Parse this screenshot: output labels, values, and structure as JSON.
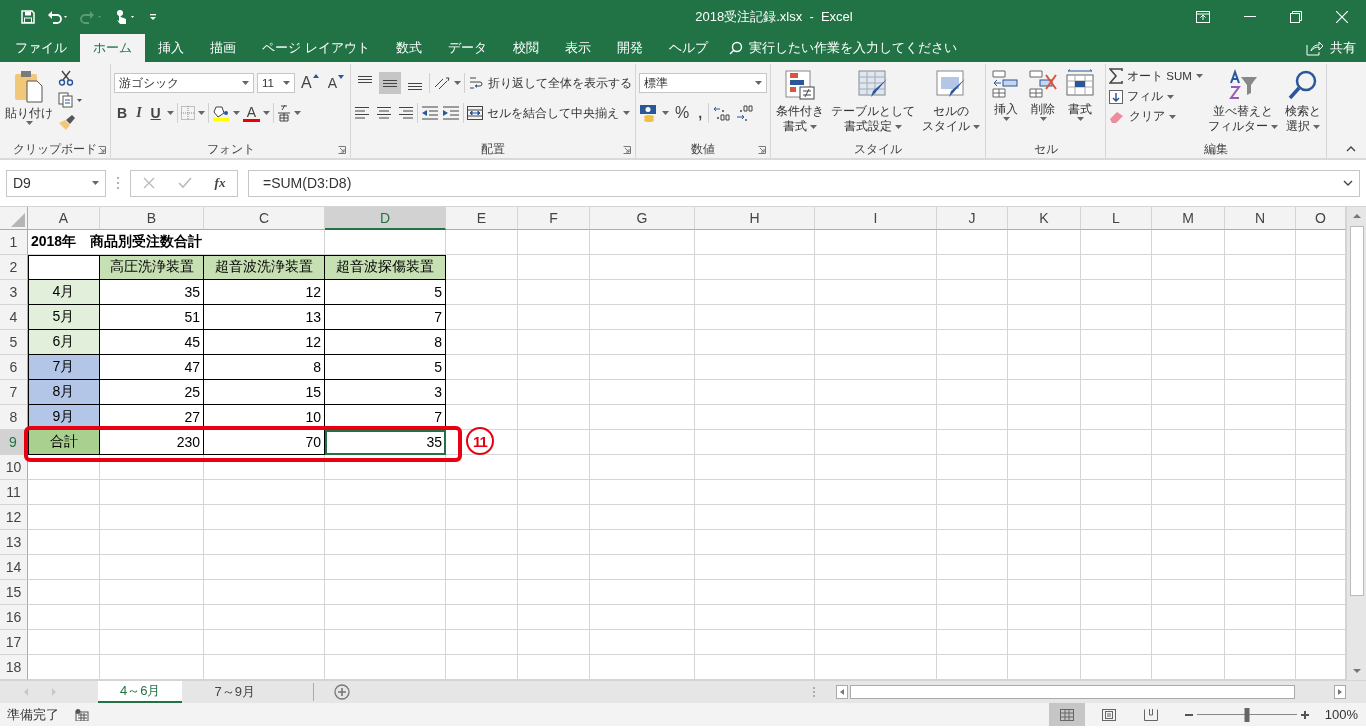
{
  "window": {
    "title": "2018受注記録.xlsx  -  Excel",
    "share": "共有"
  },
  "menu_tabs": [
    {
      "label": "ファイル",
      "selected": false
    },
    {
      "label": "ホーム",
      "selected": true
    },
    {
      "label": "挿入",
      "selected": false
    },
    {
      "label": "描画",
      "selected": false
    },
    {
      "label": "ページ レイアウト",
      "selected": false
    },
    {
      "label": "数式",
      "selected": false
    },
    {
      "label": "データ",
      "selected": false
    },
    {
      "label": "校閲",
      "selected": false
    },
    {
      "label": "表示",
      "selected": false
    },
    {
      "label": "開発",
      "selected": false
    },
    {
      "label": "ヘルプ",
      "selected": false
    }
  ],
  "tell_me": "実行したい作業を入力してください",
  "ribbon": {
    "clipboard": {
      "paste": "貼り付け",
      "group": "クリップボード"
    },
    "font": {
      "name": "游ゴシック",
      "size": "11",
      "grow": "A",
      "shrink": "A",
      "bold": "B",
      "italic": "I",
      "underline": "U",
      "font_color_label": "A",
      "group": "フォント"
    },
    "alignment": {
      "vertical": [
        {
          "selected": false
        },
        {
          "selected": true
        },
        {
          "selected": false
        }
      ],
      "wrap": "折り返して全体を表示する",
      "merge": "セルを結合して中央揃え",
      "group": "配置"
    },
    "number": {
      "format": "標準",
      "percent": "%",
      "comma": ",",
      "group": "数値"
    },
    "styles": {
      "buttons": [
        [
          "条件付き",
          "書式"
        ],
        [
          "テーブルとして",
          "書式設定"
        ],
        [
          "セルの",
          "スタイル"
        ]
      ],
      "group": "スタイル"
    },
    "cells": {
      "buttons": [
        "挿入",
        "削除",
        "書式"
      ],
      "group": "セル"
    },
    "editing": {
      "autosum": "オート SUM",
      "fill": "フィル",
      "clear": "クリア",
      "sort": [
        "並べ替えと",
        "フィルター"
      ],
      "find": [
        "検索と",
        "選択"
      ],
      "group": "編集"
    }
  },
  "formula_bar": {
    "name_box": "D9",
    "fx": "fx",
    "formula": "=SUM(D3:D8)"
  },
  "grid": {
    "columns": [
      {
        "label": "A",
        "selected": false
      },
      {
        "label": "B",
        "selected": false
      },
      {
        "label": "C",
        "selected": false
      },
      {
        "label": "D",
        "selected": true
      },
      {
        "label": "E",
        "selected": false
      },
      {
        "label": "F",
        "selected": false
      },
      {
        "label": "G",
        "selected": false
      },
      {
        "label": "H",
        "selected": false
      },
      {
        "label": "I",
        "selected": false
      },
      {
        "label": "J",
        "selected": false
      },
      {
        "label": "K",
        "selected": false
      },
      {
        "label": "L",
        "selected": false
      },
      {
        "label": "M",
        "selected": false
      },
      {
        "label": "N",
        "selected": false
      },
      {
        "label": "O",
        "selected": false
      }
    ],
    "rows": [
      {
        "number": "1",
        "selected": false,
        "cells": [
          {
            "kind": "title",
            "text": "2018年　商品別受注数合計"
          }
        ]
      },
      {
        "number": "2",
        "selected": false,
        "cells": [
          {
            "kind": "blank"
          },
          {
            "kind": "header",
            "text": "高圧洗浄装置",
            "color": "#c6e0b4"
          },
          {
            "kind": "header",
            "text": "超音波洗浄装置",
            "color": "#c6e0b4"
          },
          {
            "kind": "header",
            "text": "超音波探傷装置",
            "color": "#c6e0b4"
          }
        ]
      },
      {
        "number": "3",
        "selected": false,
        "cells": [
          {
            "kind": "label",
            "text": "4月",
            "color": "#e2efda"
          },
          {
            "kind": "number",
            "text": "35"
          },
          {
            "kind": "number",
            "text": "12"
          },
          {
            "kind": "number",
            "text": "5"
          }
        ]
      },
      {
        "number": "4",
        "selected": false,
        "cells": [
          {
            "kind": "label",
            "text": "5月",
            "color": "#e2efda"
          },
          {
            "kind": "number",
            "text": "51"
          },
          {
            "kind": "number",
            "text": "13"
          },
          {
            "kind": "number",
            "text": "7"
          }
        ]
      },
      {
        "number": "5",
        "selected": false,
        "cells": [
          {
            "kind": "label",
            "text": "6月",
            "color": "#e2efda"
          },
          {
            "kind": "number",
            "text": "45"
          },
          {
            "kind": "number",
            "text": "12"
          },
          {
            "kind": "number",
            "text": "8"
          }
        ]
      },
      {
        "number": "6",
        "selected": false,
        "cells": [
          {
            "kind": "label",
            "text": "7月",
            "color": "#b4c6e7"
          },
          {
            "kind": "number",
            "text": "47"
          },
          {
            "kind": "number",
            "text": "8"
          },
          {
            "kind": "number",
            "text": "5"
          }
        ]
      },
      {
        "number": "7",
        "selected": false,
        "cells": [
          {
            "kind": "label",
            "text": "8月",
            "color": "#b4c6e7"
          },
          {
            "kind": "number",
            "text": "25"
          },
          {
            "kind": "number",
            "text": "15"
          },
          {
            "kind": "number",
            "text": "3"
          }
        ]
      },
      {
        "number": "8",
        "selected": false,
        "cells": [
          {
            "kind": "label",
            "text": "9月",
            "color": "#b4c6e7"
          },
          {
            "kind": "number",
            "text": "27"
          },
          {
            "kind": "number",
            "text": "10"
          },
          {
            "kind": "number",
            "text": "7"
          }
        ]
      },
      {
        "number": "9",
        "selected": true,
        "cells": [
          {
            "kind": "label",
            "text": "合計",
            "color": "#a9d08e"
          },
          {
            "kind": "number",
            "text": "230"
          },
          {
            "kind": "number",
            "text": "70"
          },
          {
            "kind": "number",
            "text": "35"
          }
        ]
      },
      {
        "number": "10",
        "selected": false
      },
      {
        "number": "11",
        "selected": false
      },
      {
        "number": "12",
        "selected": false
      },
      {
        "number": "13",
        "selected": false
      },
      {
        "number": "14",
        "selected": false
      },
      {
        "number": "15",
        "selected": false
      },
      {
        "number": "16",
        "selected": false
      },
      {
        "number": "17",
        "selected": false
      },
      {
        "number": "18",
        "selected": false
      }
    ]
  },
  "callout": {
    "text": "11"
  },
  "sheet_tabs": [
    {
      "label": "4～6月",
      "selected": true
    },
    {
      "label": "7～9月",
      "selected": false
    }
  ],
  "status_bar": {
    "text": "準備完了",
    "views": [
      {
        "selected": true
      },
      {
        "selected": false
      },
      {
        "selected": false
      }
    ],
    "zoom": {
      "level": 0.5,
      "text": "100%"
    }
  }
}
